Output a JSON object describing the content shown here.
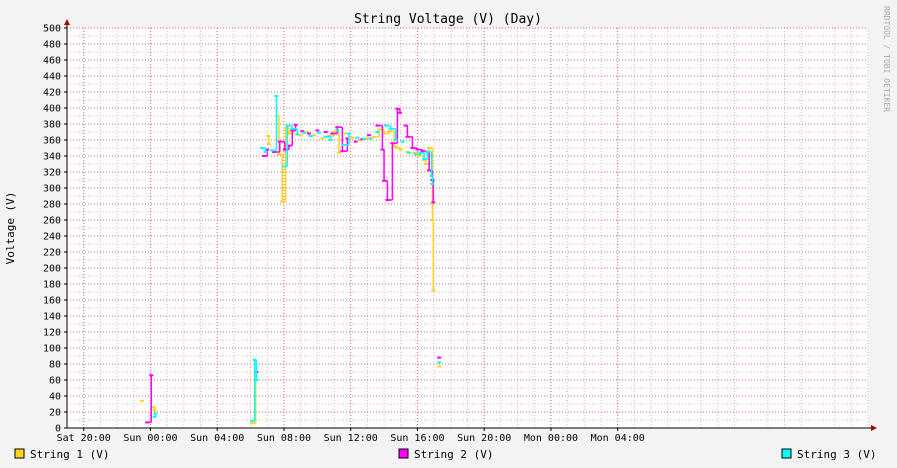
{
  "chart_data": {
    "type": "line",
    "title": "String Voltage (V) (Day)",
    "ylabel": "Voltage (V)",
    "watermark": "RRDTOOL / TOBI OETIKER",
    "ylim": [
      0,
      500
    ],
    "y_major_step": 20,
    "y_minor_step": 10,
    "x_hours_range": [
      -5,
      43
    ],
    "x_ticks": [
      {
        "label": "Sat 20:00",
        "h": -4
      },
      {
        "label": "Sun 00:00",
        "h": 0
      },
      {
        "label": "Sun 04:00",
        "h": 4
      },
      {
        "label": "Sun 08:00",
        "h": 8
      },
      {
        "label": "Sun 12:00",
        "h": 12
      },
      {
        "label": "Sun 16:00",
        "h": 16
      },
      {
        "label": "Sun 20:00",
        "h": 20
      },
      {
        "label": "Mon 00:00",
        "h": 24
      },
      {
        "label": "Mon 04:00",
        "h": 28
      }
    ],
    "x_minor_step_hours": 1,
    "colors": {
      "background": "#f3f3f3",
      "plot_background": "#ffffff",
      "grid_minor": "#e8b4b4",
      "grid_major": "#e06060",
      "axis": "#000000",
      "arrow": "#aa0000"
    },
    "series": [
      {
        "name": "String 1 (V)",
        "color": "#ffd21f",
        "points": [
          [
            -0.5,
            34
          ],
          [
            0.2,
            26
          ],
          [
            0.25,
            22
          ],
          [
            6.1,
            6
          ],
          [
            6.3,
            66
          ],
          [
            7.05,
            365
          ],
          [
            7.1,
            355
          ],
          [
            7.6,
            390
          ],
          [
            7.7,
            342
          ],
          [
            7.9,
            283
          ],
          [
            8.1,
            375
          ],
          [
            8.3,
            368
          ],
          [
            8.6,
            372
          ],
          [
            9.0,
            366
          ],
          [
            9.4,
            370
          ],
          [
            9.8,
            366
          ],
          [
            10.3,
            362
          ],
          [
            10.7,
            365
          ],
          [
            11.0,
            370
          ],
          [
            11.3,
            344
          ],
          [
            11.7,
            368
          ],
          [
            12.1,
            363
          ],
          [
            12.6,
            360
          ],
          [
            13.0,
            362
          ],
          [
            13.4,
            364
          ],
          [
            13.7,
            373
          ],
          [
            14.0,
            368
          ],
          [
            14.3,
            371
          ],
          [
            14.6,
            352
          ],
          [
            14.8,
            350
          ],
          [
            15.0,
            348
          ],
          [
            15.4,
            345
          ],
          [
            15.8,
            344
          ],
          [
            16.1,
            340
          ],
          [
            16.4,
            335
          ],
          [
            16.5,
            330
          ],
          [
            16.7,
            350
          ],
          [
            16.9,
            260
          ],
          [
            16.95,
            172
          ],
          [
            17.3,
            77
          ]
        ]
      },
      {
        "name": "String 2 (V)",
        "color": "#ff00ff",
        "points": [
          [
            -0.2,
            7
          ],
          [
            0.05,
            66
          ],
          [
            6.35,
            70
          ],
          [
            6.8,
            340
          ],
          [
            7.0,
            348
          ],
          [
            7.4,
            345
          ],
          [
            7.75,
            358
          ],
          [
            8.05,
            348
          ],
          [
            8.3,
            353
          ],
          [
            8.5,
            372
          ],
          [
            8.7,
            379
          ],
          [
            9.1,
            371
          ],
          [
            9.5,
            368
          ],
          [
            10.0,
            372
          ],
          [
            10.5,
            370
          ],
          [
            10.9,
            368
          ],
          [
            11.2,
            376
          ],
          [
            11.5,
            346
          ],
          [
            11.8,
            362
          ],
          [
            12.3,
            358
          ],
          [
            12.7,
            361
          ],
          [
            13.1,
            366
          ],
          [
            13.6,
            378
          ],
          [
            13.9,
            348
          ],
          [
            14.0,
            309
          ],
          [
            14.2,
            285
          ],
          [
            14.5,
            356
          ],
          [
            14.8,
            399
          ],
          [
            14.95,
            394
          ],
          [
            15.3,
            378
          ],
          [
            15.4,
            364
          ],
          [
            15.7,
            350
          ],
          [
            16.0,
            348
          ],
          [
            16.3,
            346
          ],
          [
            16.6,
            345
          ],
          [
            16.7,
            322
          ],
          [
            16.9,
            310
          ],
          [
            16.95,
            282
          ],
          [
            17.3,
            88
          ]
        ]
      },
      {
        "name": "String 3 (V)",
        "color": "#00ffff",
        "points": [
          [
            0.25,
            14
          ],
          [
            0.3,
            18
          ],
          [
            6.1,
            9
          ],
          [
            6.25,
            85
          ],
          [
            6.35,
            60
          ],
          [
            6.7,
            350
          ],
          [
            6.9,
            345
          ],
          [
            7.3,
            347
          ],
          [
            7.55,
            415
          ],
          [
            8.0,
            327
          ],
          [
            8.2,
            378
          ],
          [
            8.5,
            374
          ],
          [
            8.8,
            367
          ],
          [
            9.2,
            369
          ],
          [
            9.6,
            365
          ],
          [
            10.1,
            369
          ],
          [
            10.5,
            364
          ],
          [
            10.8,
            360
          ],
          [
            11.2,
            372
          ],
          [
            11.6,
            354
          ],
          [
            11.9,
            368
          ],
          [
            12.4,
            363
          ],
          [
            12.8,
            361
          ],
          [
            13.2,
            362
          ],
          [
            13.6,
            370
          ],
          [
            14.1,
            378
          ],
          [
            14.4,
            374
          ],
          [
            14.7,
            360
          ],
          [
            15.1,
            358
          ],
          [
            15.5,
            344
          ],
          [
            15.9,
            342
          ],
          [
            16.2,
            344
          ],
          [
            16.4,
            336
          ],
          [
            16.6,
            345
          ],
          [
            16.85,
            315
          ],
          [
            16.9,
            305
          ],
          [
            17.3,
            82
          ]
        ]
      }
    ]
  }
}
